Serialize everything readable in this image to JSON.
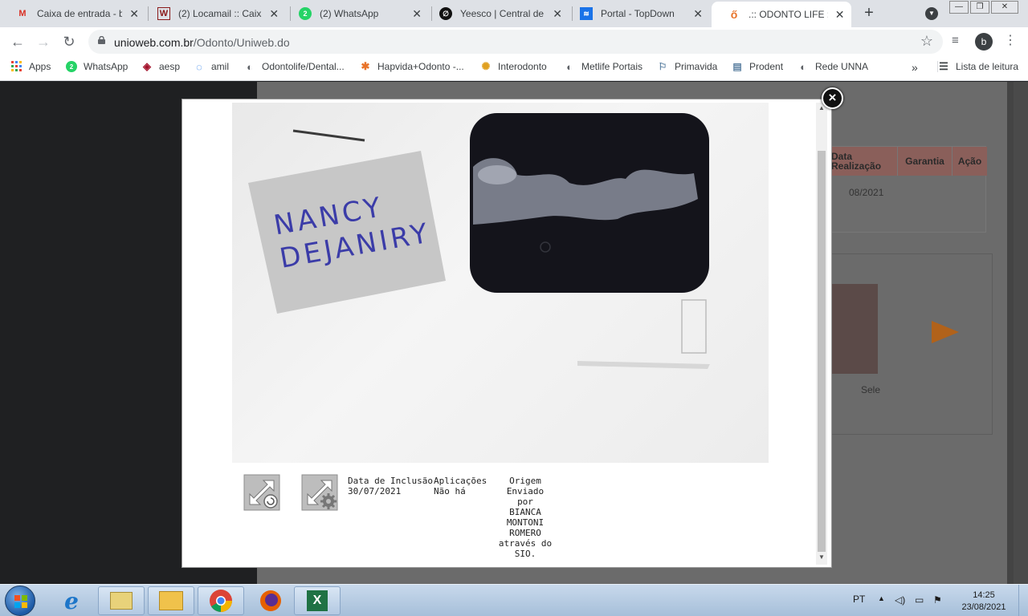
{
  "browser": {
    "tabs": [
      {
        "title": "Caixa de entrada - bi",
        "icon": "gmail-icon"
      },
      {
        "title": "(2) Locamail :: Caixa d",
        "icon": "locamail-icon"
      },
      {
        "title": "(2) WhatsApp",
        "icon": "whatsapp-icon"
      },
      {
        "title": "Yeesco | Central de A",
        "icon": "yeesco-icon"
      },
      {
        "title": "Portal - TopDown",
        "icon": "topdown-icon"
      },
      {
        "title": ".:: ODONTO LIFE ::.",
        "icon": "odontolife-icon"
      }
    ],
    "new_tab": "+",
    "url_host": "unioweb.com.br",
    "url_path": "/Odonto/Uniweb.do",
    "profile_initial": "b",
    "window_minimize": "—",
    "window_restore": "❐",
    "window_close": "✕",
    "bookmarks": [
      {
        "label": "Apps"
      },
      {
        "label": "WhatsApp"
      },
      {
        "label": "aesp"
      },
      {
        "label": "amil"
      },
      {
        "label": "Odontolife/Dental..."
      },
      {
        "label": "Hapvida+Odonto -..."
      },
      {
        "label": "Interodonto"
      },
      {
        "label": "Metlife Portais"
      },
      {
        "label": "Primavida"
      },
      {
        "label": "Prodent"
      },
      {
        "label": "Rede UNNA"
      }
    ],
    "bookmarks_overflow": "»",
    "reading_list": "Lista de leitura",
    "whatsapp_badge": "2"
  },
  "background_page": {
    "table_headers": [
      "Data\nRealização",
      "Garantia",
      "Ação"
    ],
    "table_date": "08/2021",
    "selecionar_partial": "Sele"
  },
  "modal": {
    "photo_note_line1": "NANCY",
    "photo_note_line2": "DEJANIRY",
    "close_label": "×",
    "data_inclusao_label": "Data de Inclusão",
    "data_inclusao_value": "30/07/2021",
    "aplicacoes_label": "Aplicações",
    "aplicacoes_value": "Não há",
    "origem_label": "Origem",
    "origem_line1": "Enviado por",
    "origem_line2": "BIANCA",
    "origem_line3": "MONTONI",
    "origem_line4": "ROMERO",
    "origem_line5": "através do",
    "origem_line6": "SIO."
  },
  "taskbar": {
    "language": "PT",
    "time": "14:25",
    "date": "23/08/2021"
  },
  "colors": {
    "chrome_tabstrip": "#dee1e6",
    "overlay_dark": "#1f2022",
    "table_header": "#8a5f5a",
    "arrow_orange": "#b1621a",
    "taskbar": "#b3c9e2"
  }
}
